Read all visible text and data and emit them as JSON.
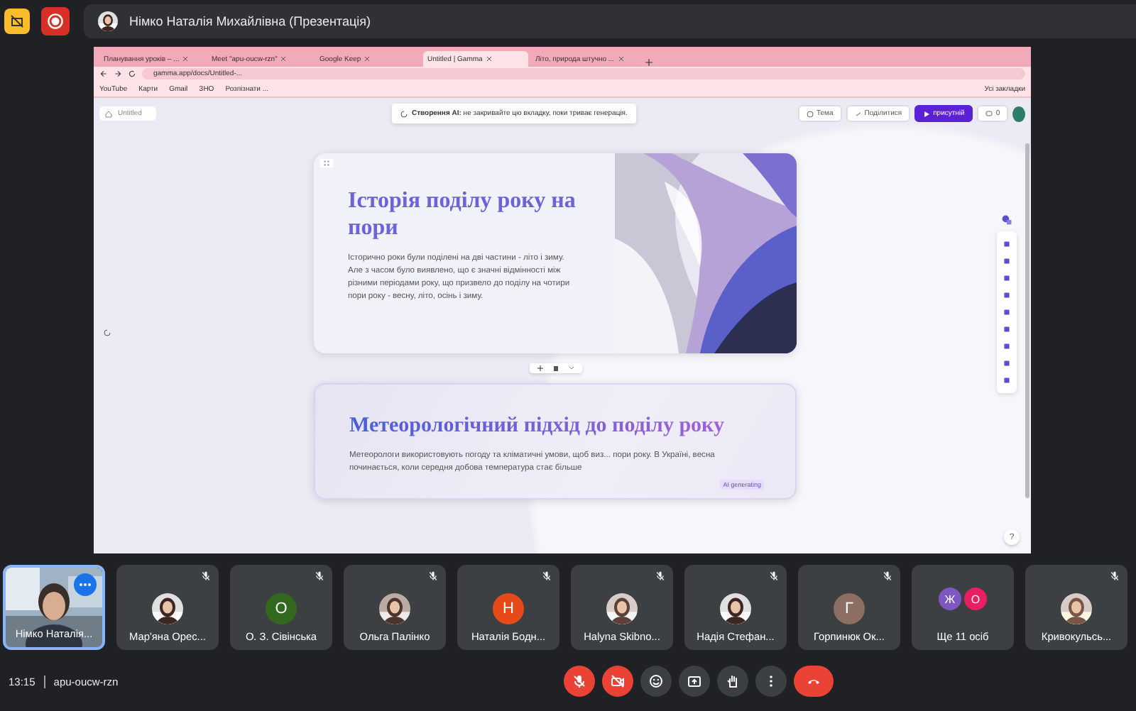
{
  "meet": {
    "presenter": "Німко Наталія Михайлівна (Презентація)"
  },
  "browser": {
    "tabs": [
      {
        "label": "Планування уроків – ...",
        "selected": false
      },
      {
        "label": "Meet \"apu-oucw-rzn\"",
        "selected": false
      },
      {
        "label": "Google Keep",
        "selected": false
      },
      {
        "label": "Untitled | Gamma",
        "selected": true
      },
      {
        "label": "Літо, природа штучно ...",
        "selected": false
      }
    ],
    "url": "gamma.app/docs/Untitled-...",
    "bookmarks": [
      "YouTube",
      "Карти",
      "Gmail",
      "ЗНО",
      "Розпізнати ..."
    ],
    "all_bookmarks": "Усі закладки"
  },
  "gamma": {
    "breadcrumb": "Untitled",
    "toast": "**Створення AI:** не закривайте цю вкладку, поки триває генерація.",
    "buttons": [
      {
        "kind": "theme",
        "label": "Тема"
      },
      {
        "kind": "share",
        "label": "Поділитися"
      },
      {
        "kind": "present",
        "label": "присутній"
      },
      {
        "kind": "comments",
        "label": "0"
      }
    ],
    "cards": [
      {
        "title": "Історія поділу року на пори",
        "body": "Історично роки були поділені на дві частини - літо і зиму. Але з часом було виявлено, що є значні відмінності між різними періодами року, що призвело до поділу на чотири пори року - весну, літо, осінь і зиму."
      },
      {
        "kind": "text",
        "title": "Метеорологічний підхід до поділу року",
        "body": "Метеорологи використовують погоду та кліматичні умови, щоб виз... пори року. В Україні, весна починається, коли середня добова температура стає більше",
        "badge": "AI generating"
      }
    ],
    "help": "?"
  },
  "participants": [
    {
      "kind": "video",
      "name": "Німко Наталія...",
      "muted": false
    },
    {
      "name": "Мар'яна Орес...",
      "muted": true
    },
    {
      "kind": "letter",
      "letter": "О",
      "color": "#33691e",
      "name": "О. З. Сівінська",
      "muted": true
    },
    {
      "name": "Ольга Палінко",
      "muted": true
    },
    {
      "kind": "letter",
      "letter": "Н",
      "color": "#e64a19",
      "name": "Наталія Бодн...",
      "muted": true
    },
    {
      "name": "Halyna Skibno...",
      "muted": true
    },
    {
      "name": "Надія Стефан...",
      "muted": true
    },
    {
      "kind": "letter",
      "letter": "Г",
      "color": "#8d6e63",
      "name": "Горпинюк Ок...",
      "muted": true
    },
    {
      "kind": "more",
      "letters": [
        {
          "letter": "Ж",
          "color": "#7e57c2"
        },
        {
          "letter": "О",
          "color": "#e91e63"
        }
      ],
      "name": "Ще 11 осіб",
      "muted": false
    },
    {
      "name": "Кривокульсь...",
      "muted": true
    }
  ],
  "footer": {
    "time": "13:15",
    "code": "apu-oucw-rzn"
  },
  "controls": [
    {
      "kind": "mic",
      "off": true
    },
    {
      "kind": "camera",
      "off": true
    },
    {
      "kind": "emoji"
    },
    {
      "kind": "present"
    },
    {
      "kind": "hand"
    },
    {
      "kind": "more"
    },
    {
      "kind": "leave"
    }
  ]
}
